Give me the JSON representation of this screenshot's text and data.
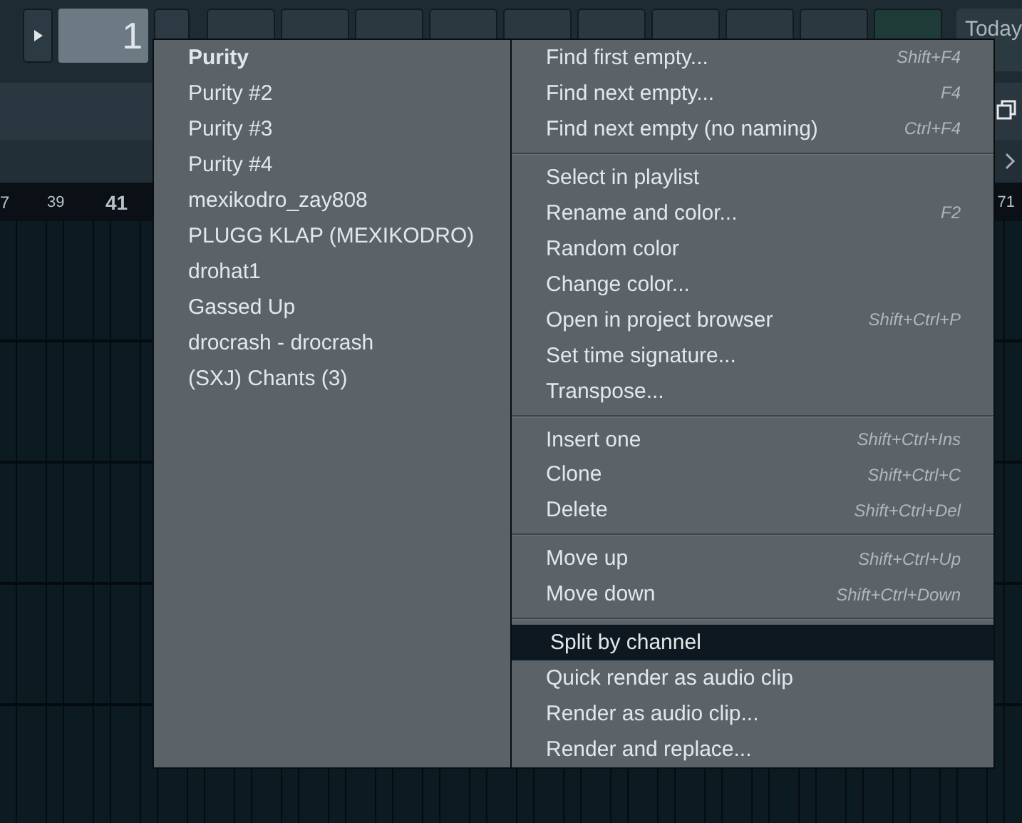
{
  "toolbar": {
    "pattern_number": "1",
    "today": "Today"
  },
  "ruler": {
    "left_labels": [
      "7",
      "39",
      "41"
    ],
    "right_label": "71"
  },
  "pattern_menu": [
    {
      "label": "Purity",
      "selected": true
    },
    {
      "label": "Purity #2",
      "selected": false
    },
    {
      "label": "Purity #3",
      "selected": false
    },
    {
      "label": "Purity #4",
      "selected": false
    },
    {
      "label": "mexikodro_zay808",
      "selected": false
    },
    {
      "label": "PLUGG KLAP (MEXIKODRO)",
      "selected": false
    },
    {
      "label": "drohat1",
      "selected": false
    },
    {
      "label": "Gassed Up",
      "selected": false
    },
    {
      "label": "drocrash - drocrash",
      "selected": false
    },
    {
      "label": "(SXJ) Chants (3)",
      "selected": false
    }
  ],
  "action_menu": [
    [
      {
        "label": "Find first empty...",
        "shortcut": "Shift+F4",
        "selected": false
      },
      {
        "label": "Find next empty...",
        "shortcut": "F4",
        "selected": false
      },
      {
        "label": "Find next empty (no naming)",
        "shortcut": "Ctrl+F4",
        "selected": false
      }
    ],
    [
      {
        "label": "Select in playlist",
        "selected": false
      },
      {
        "label": "Rename and color...",
        "shortcut": "F2",
        "selected": false
      },
      {
        "label": "Random color",
        "selected": false
      },
      {
        "label": "Change color...",
        "selected": false
      },
      {
        "label": "Open in project browser",
        "shortcut": "Shift+Ctrl+P",
        "selected": false
      },
      {
        "label": "Set time signature...",
        "selected": false
      },
      {
        "label": "Transpose...",
        "selected": false
      }
    ],
    [
      {
        "label": "Insert one",
        "shortcut": "Shift+Ctrl+Ins",
        "selected": false
      },
      {
        "label": "Clone",
        "shortcut": "Shift+Ctrl+C",
        "selected": false
      },
      {
        "label": "Delete",
        "shortcut": "Shift+Ctrl+Del",
        "selected": false
      }
    ],
    [
      {
        "label": "Move up",
        "shortcut": "Shift+Ctrl+Up",
        "selected": false
      },
      {
        "label": "Move down",
        "shortcut": "Shift+Ctrl+Down",
        "selected": false
      }
    ],
    [
      {
        "label": "Split by channel",
        "selected": true
      },
      {
        "label": "Quick render as audio clip",
        "selected": false
      },
      {
        "label": "Render as audio clip...",
        "selected": false
      },
      {
        "label": "Render and replace...",
        "selected": false
      }
    ]
  ]
}
